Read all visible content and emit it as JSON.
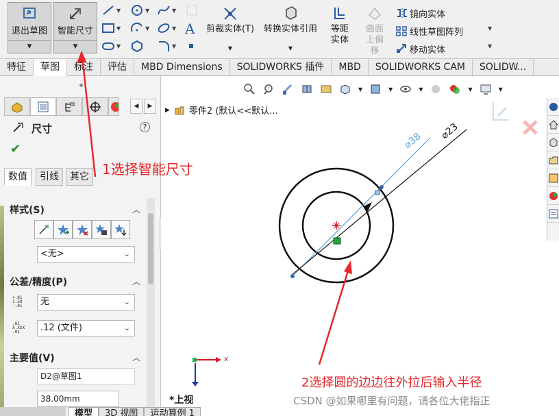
{
  "ribbon": {
    "exit_sketch": "退出草图",
    "smart_dimension": "智能尺寸",
    "trim_entities": "剪裁实体(T)",
    "convert_entities": "转换实体引用",
    "offset_entities": "等距实体",
    "surface_offset": "曲面上偏移",
    "mirror_entities": "镜向实体",
    "linear_pattern": "线性草图阵列",
    "move_entities": "移动实体"
  },
  "tabs": [
    "特征",
    "草图",
    "标注",
    "评估",
    "MBD Dimensions",
    "SOLIDWORKS 插件",
    "MBD",
    "SOLIDWORKS CAM",
    "SOLIDW..."
  ],
  "panel": {
    "title": "尺寸",
    "help": "?",
    "subtabs": [
      "数值",
      "引线",
      "其它"
    ],
    "style_section": "样式(S)",
    "style_combo": "<无>",
    "tolerance_section": "公差/精度(P)",
    "tolerance_value": "无",
    "precision_value": ".12 (文件)",
    "tol_icon_text": "+.01 1.50 -.01",
    "prec_icon_text": ".01 X.XXX .01",
    "primary_section": "主要值(V)",
    "dim_name": "D2@草图1",
    "dim_value": "38.00mm"
  },
  "tree": {
    "label": "零件2 (默认<<默认..."
  },
  "drawing": {
    "dim_outer": "⌀38",
    "dim_inner": "⌀23"
  },
  "view_name": "*上视",
  "axis_x": "x",
  "annotations": {
    "step1": "1选择智能尺寸",
    "step2": "2选择圆的边边往外拉后输入半径"
  },
  "watermark": "CSDN @如果哪里有问题，请各位大佬指正",
  "bottom_tabs": [
    "模型",
    "3D 视图",
    "运动算例 1"
  ],
  "colors": {
    "annotation_red": "#e8262b",
    "dim_blue": "#5aa3d8",
    "origin_red": "#d8182a",
    "axis_blue": "#1a3aa6"
  }
}
